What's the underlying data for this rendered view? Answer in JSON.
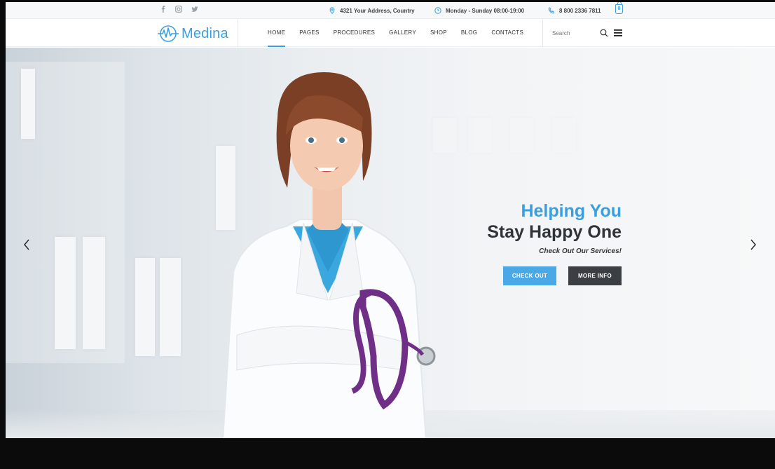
{
  "topbar": {
    "social": [
      "facebook-icon",
      "instagram-icon",
      "twitter-icon"
    ],
    "address": "4321 Your Address, Country",
    "hours": "Monday - Sunday 08:00-19:00",
    "phone": "8 800 2336 7811",
    "cart_count": "0"
  },
  "header": {
    "logo_text": "Medina",
    "nav": [
      "HOME",
      "PAGES",
      "PROCEDURES",
      "GALLERY",
      "SHOP",
      "BLOG",
      "CONTACTS"
    ],
    "active_nav": "HOME",
    "search_placeholder": "Search"
  },
  "hero": {
    "title_line1": "Helping You",
    "title_line2": "Stay Happy One",
    "subtitle": "Check Out Our Services!",
    "button_primary": "CHECK OUT",
    "button_secondary": "MORE INFO"
  },
  "colors": {
    "accent": "#3a9fe0",
    "dark": "#2f3439",
    "button_blue": "#4aa8e6",
    "button_dark": "#3b3f43"
  }
}
